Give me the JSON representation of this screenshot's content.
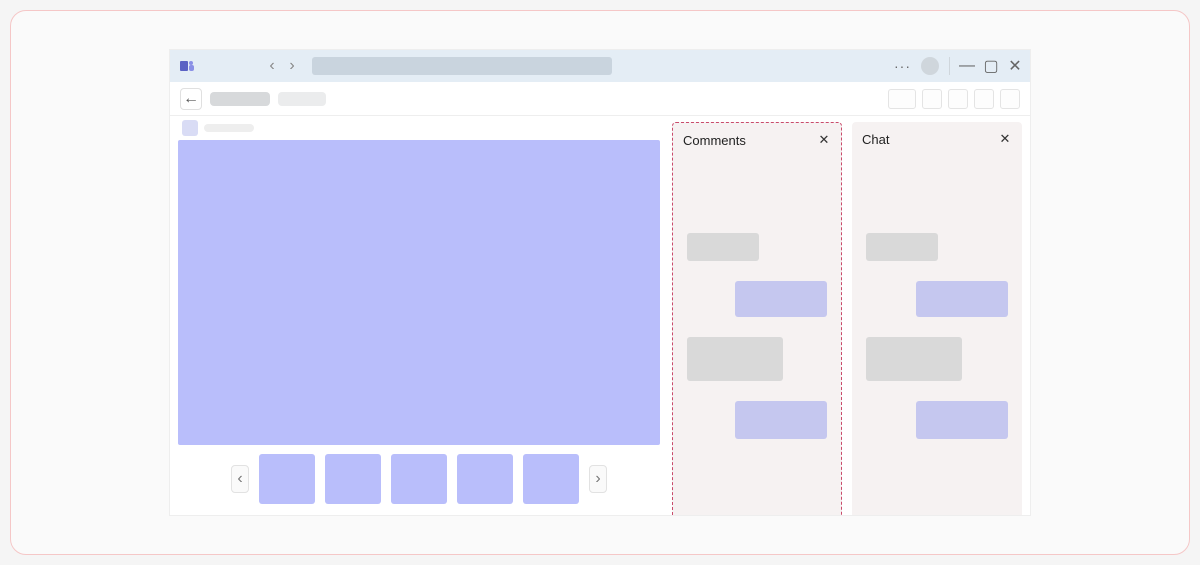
{
  "titlebar": {
    "app_icon": "teams-icon",
    "back_label": "‹",
    "forward_label": "›",
    "search_placeholder": "",
    "more_label": "···",
    "minimize_label": "—",
    "maximize_label": "▢",
    "close_label": "✕"
  },
  "subheader": {
    "back_arrow": "←",
    "crumb_a": "",
    "crumb_b": ""
  },
  "panels": {
    "comments": {
      "title": "Comments",
      "close": "✕"
    },
    "chat": {
      "title": "Chat",
      "close": "✕"
    }
  },
  "thumbs": {
    "count": 5,
    "prev": "‹",
    "next": "›"
  },
  "colors": {
    "stage": "#b9befb",
    "panel_bg": "#f6f2f2",
    "dash_border": "#c94b6b",
    "msg_gray": "#d9d9d9",
    "msg_purple": "#c5c7ef"
  }
}
